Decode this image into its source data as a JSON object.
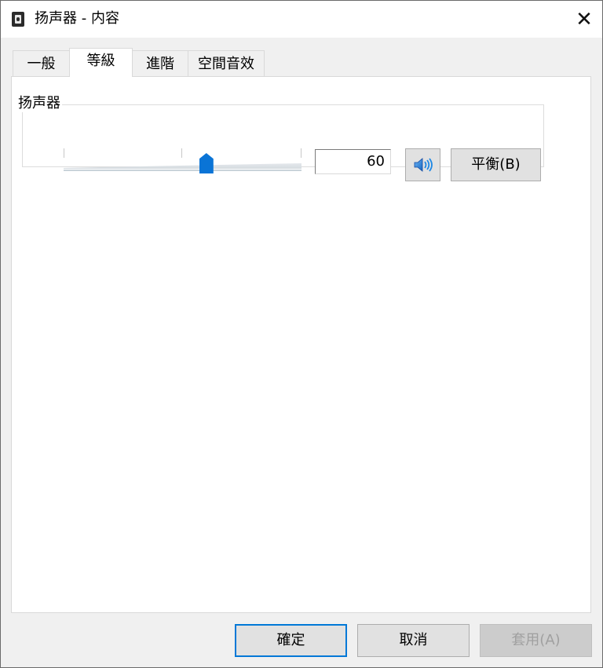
{
  "window": {
    "title": "扬声器 - 内容",
    "close_glyph": "✕"
  },
  "tabs": [
    {
      "label": "一般",
      "active": false
    },
    {
      "label": "等級",
      "active": true
    },
    {
      "label": "進階",
      "active": false
    },
    {
      "label": "空間音效",
      "active": false
    }
  ],
  "levels": {
    "group_label": "扬声器",
    "volume": 60,
    "volume_text": "60",
    "mute_icon": "speaker-icon",
    "balance_label": "平衡(B)"
  },
  "footer": {
    "ok_label": "確定",
    "cancel_label": "取消",
    "apply_label": "套用(A)"
  },
  "colors": {
    "accent": "#0078d7",
    "thumb": "#0a74d6"
  }
}
